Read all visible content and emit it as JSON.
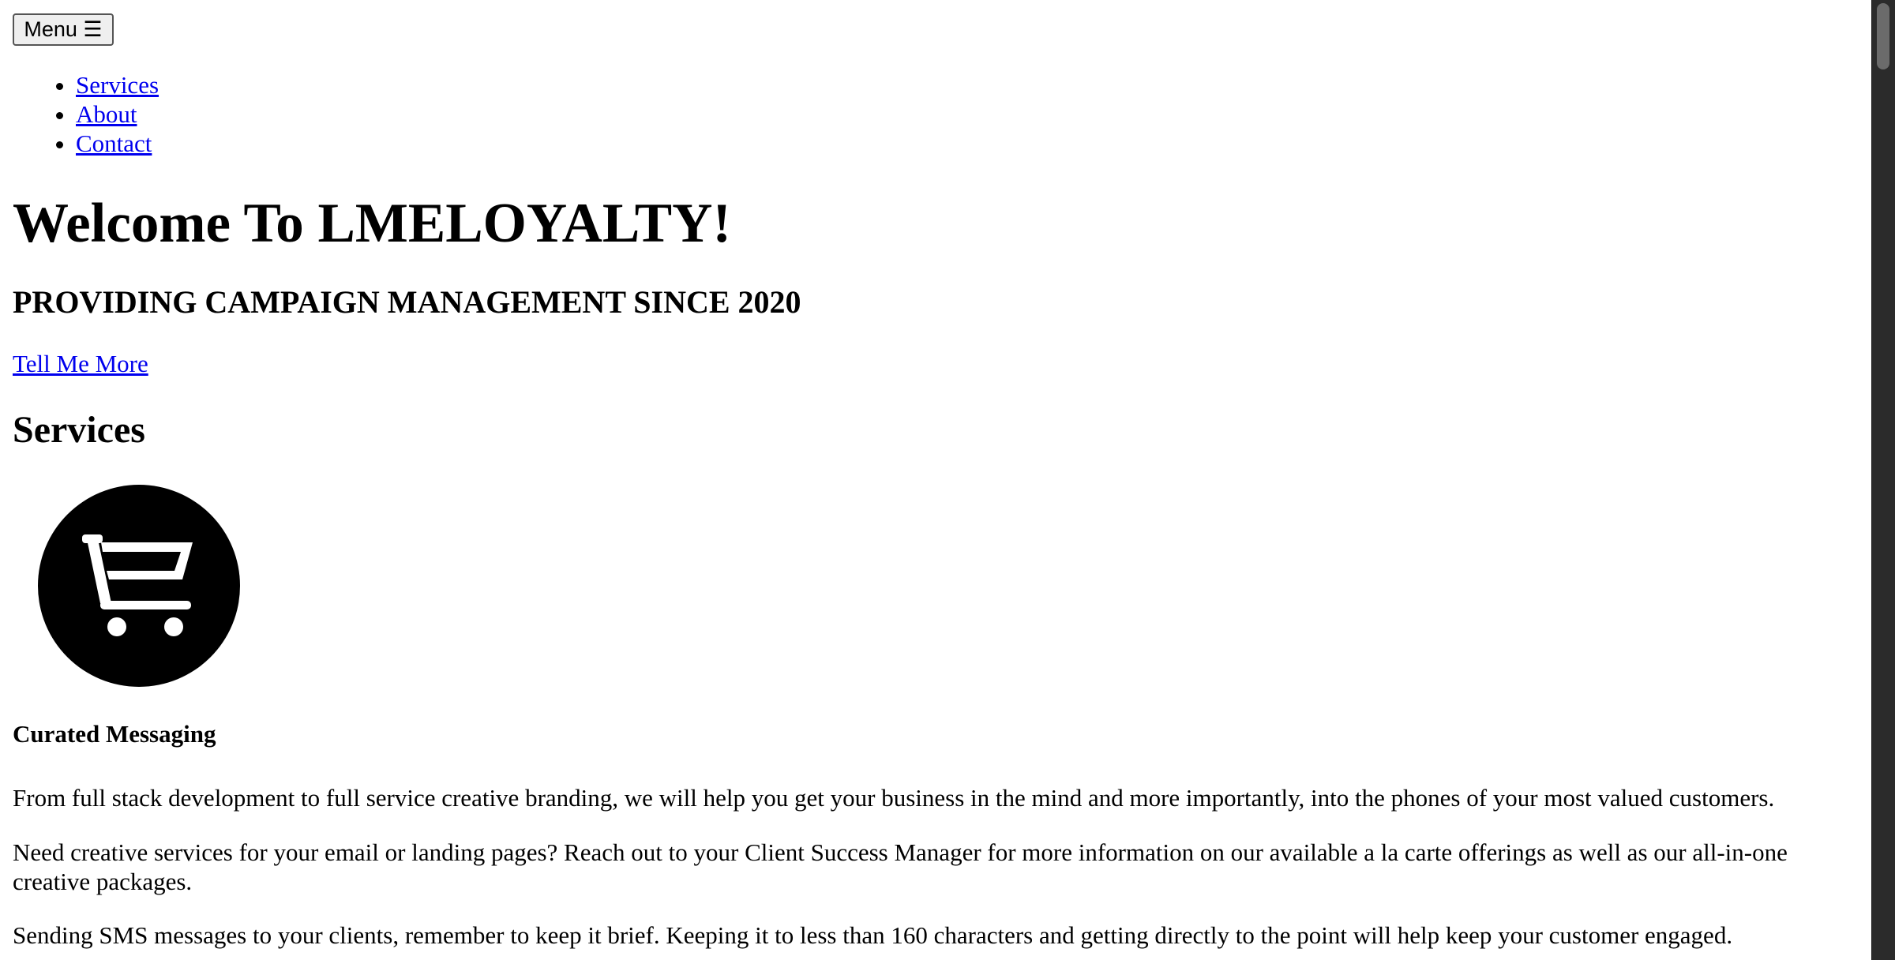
{
  "header": {
    "menu_button": "Menu ☰"
  },
  "nav": {
    "items": [
      {
        "label": "Services"
      },
      {
        "label": "About"
      },
      {
        "label": "Contact"
      }
    ]
  },
  "hero": {
    "title": "Welcome To LMELOYALTY!",
    "subtitle": "PROVIDING CAMPAIGN MANAGEMENT SINCE 2020",
    "cta_label": "Tell Me More"
  },
  "services": {
    "heading": "Services",
    "items": [
      {
        "icon": "shopping-cart-icon",
        "title": "Curated Messaging",
        "paragraphs": [
          "From full stack development to full service creative branding, we will help you get your business in the mind and more importantly, into the phones of your most valued customers.",
          "Need creative services for your email or landing pages? Reach out to your Client Success Manager for more information on our available a la carte offerings as well as our all-in-one creative packages.",
          "Sending SMS messages to your clients, remember to keep it brief. Keeping it to less than 160 characters and getting directly to the point will help keep your customer engaged."
        ]
      }
    ]
  },
  "colors": {
    "link": "#0000ee",
    "text": "#000000",
    "icon_circle": "#000000",
    "icon_glyph": "#ffffff",
    "scrollbar_track": "#2b2b2b",
    "scrollbar_thumb": "#6b6b6b"
  }
}
